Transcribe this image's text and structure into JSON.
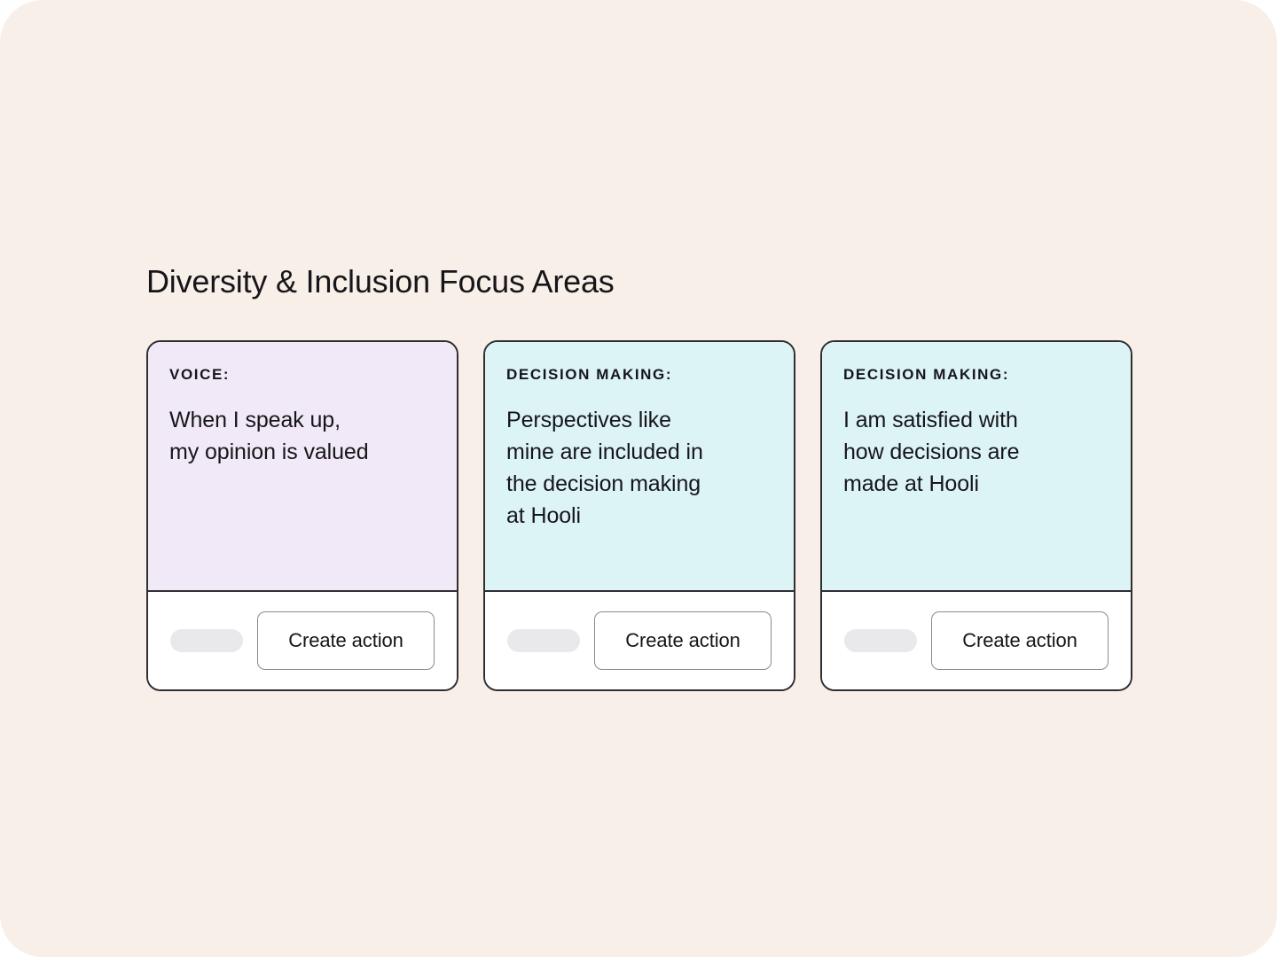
{
  "page": {
    "background_color": "#f9efe9",
    "title": "Diversity & Inclusion Focus Areas"
  },
  "cards": [
    {
      "label": "VOICE:",
      "text": "When I speak up,\nmy opinion is valued",
      "background_color": "#f1e9f7",
      "button_label": "Create action"
    },
    {
      "label": "DECISION MAKING:",
      "text": "Perspectives like\nmine are included in\nthe decision making\nat Hooli",
      "background_color": "#ddf4f6",
      "button_label": "Create action"
    },
    {
      "label": "DECISION MAKING:",
      "text": "I am satisfied with\nhow decisions are\nmade at Hooli",
      "background_color": "#ddf4f6",
      "button_label": "Create action"
    }
  ]
}
